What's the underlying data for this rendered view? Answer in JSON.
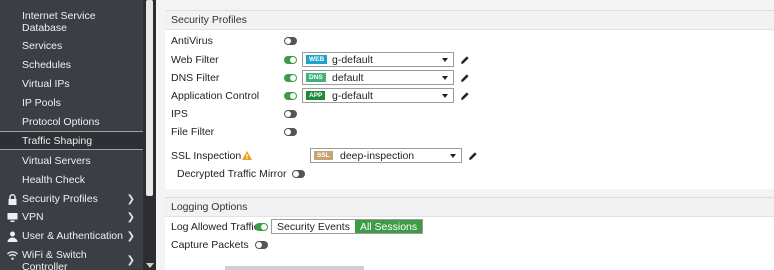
{
  "sidebar": {
    "partial_top": "Internet Service Database",
    "items": [
      {
        "label": "Internet Service"
      },
      {
        "label": "Database"
      },
      {
        "label": "Services"
      },
      {
        "label": "Schedules"
      },
      {
        "label": "Virtual IPs"
      },
      {
        "label": "IP Pools"
      },
      {
        "label": "Protocol Options"
      },
      {
        "label": "Traffic Shaping"
      },
      {
        "label": "Virtual Servers"
      },
      {
        "label": "Health Check"
      }
    ],
    "groups": [
      {
        "label": "Security Profiles",
        "icon": "lock-icon"
      },
      {
        "label": "VPN",
        "icon": "computer-icon"
      },
      {
        "label": "User & Authentication",
        "icon": "user-icon"
      },
      {
        "label": "WiFi & Switch",
        "icon": "wifi-icon"
      },
      {
        "label": "Controller"
      }
    ]
  },
  "security_profiles": {
    "title": "Security Profiles",
    "antivirus": {
      "label": "AntiVirus",
      "enabled": false
    },
    "web_filter": {
      "label": "Web Filter",
      "enabled": true,
      "badge": "WEB",
      "badge_color": "#1fa3c9",
      "value": "g-default"
    },
    "dns_filter": {
      "label": "DNS Filter",
      "enabled": true,
      "badge": "DNS",
      "badge_color": "#3fb37a",
      "value": "default"
    },
    "app_control": {
      "label": "Application Control",
      "enabled": true,
      "badge": "APP",
      "badge_color": "#1e8a3c",
      "value": "g-default"
    },
    "ips": {
      "label": "IPS",
      "enabled": false
    },
    "file_filter": {
      "label": "File Filter",
      "enabled": false
    },
    "ssl_inspection": {
      "label": "SSL Inspection",
      "badge": "SSL",
      "badge_color": "#c7a275",
      "value": "deep-inspection"
    },
    "decrypted_mirror": {
      "label": "Decrypted Traffic Mirror",
      "enabled": false
    }
  },
  "logging_options": {
    "title": "Logging Options",
    "log_allowed": {
      "label": "Log Allowed Traffic",
      "enabled": true,
      "options": [
        "Security Events",
        "All Sessions"
      ],
      "selected": "All Sessions"
    },
    "capture_packets": {
      "label": "Capture Packets",
      "enabled": false
    }
  },
  "colors": {
    "toggle_on": "#3f9c46",
    "sidebar_bg": "#3b3e44",
    "warning": "#e8a317"
  }
}
